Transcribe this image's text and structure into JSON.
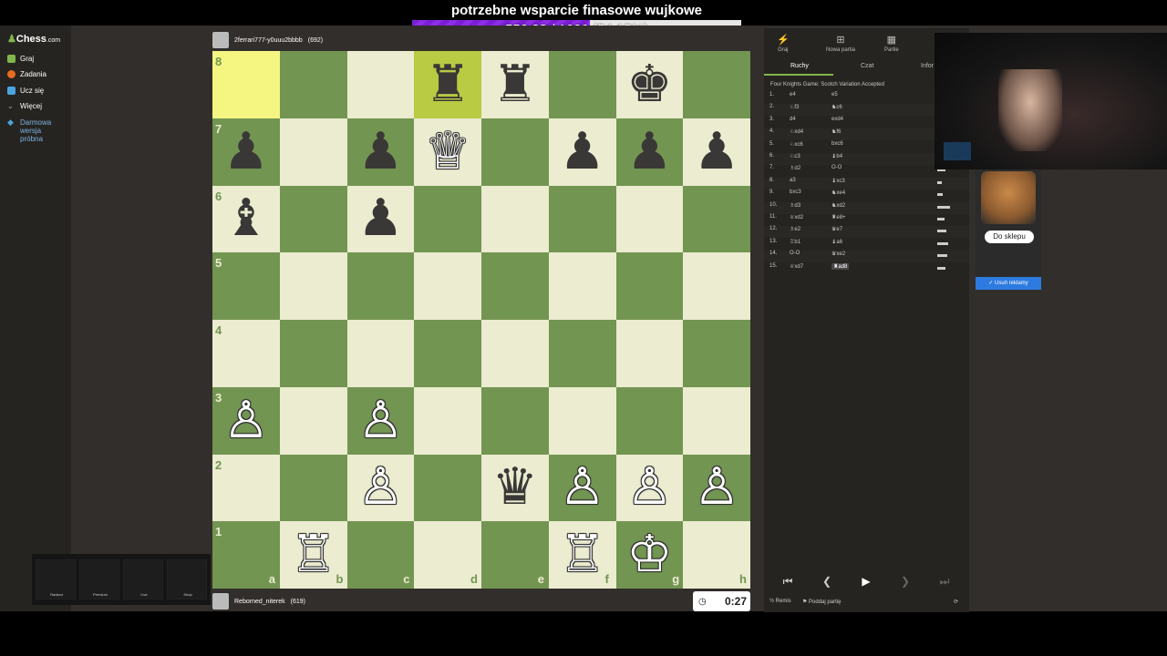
{
  "donation": {
    "title": "potrzebne wsparcie finasowe wujkowe",
    "progress_text": "552.38 / 1020 (54.15%)",
    "progress_fraction": 0.5415,
    "fill_color": "#7a1fd6"
  },
  "sidebar": {
    "logo_text": "Chess",
    "logo_suffix": ".com",
    "items": [
      {
        "label": "Graj",
        "icon": "play-icon"
      },
      {
        "label": "Zadania",
        "icon": "puzzle-icon"
      },
      {
        "label": "Ucz się",
        "icon": "learn-icon"
      },
      {
        "label": "Więcej",
        "icon": "chevron-down-icon"
      }
    ],
    "free_trial": "Darmowa wersja próbna"
  },
  "board": {
    "files": [
      "a",
      "b",
      "c",
      "d",
      "e",
      "f",
      "g",
      "h"
    ],
    "ranks": [
      "8",
      "7",
      "6",
      "5",
      "4",
      "3",
      "2",
      "1"
    ],
    "highlight": [
      "a8",
      "d8"
    ],
    "pieces": [
      {
        "sq": "d8",
        "p": "♜",
        "c": "b"
      },
      {
        "sq": "e8",
        "p": "♜",
        "c": "b"
      },
      {
        "sq": "g8",
        "p": "♚",
        "c": "b"
      },
      {
        "sq": "a7",
        "p": "♟",
        "c": "b"
      },
      {
        "sq": "c7",
        "p": "♟",
        "c": "b"
      },
      {
        "sq": "d7",
        "p": "♕",
        "c": "w"
      },
      {
        "sq": "f7",
        "p": "♟",
        "c": "b"
      },
      {
        "sq": "g7",
        "p": "♟",
        "c": "b"
      },
      {
        "sq": "h7",
        "p": "♟",
        "c": "b"
      },
      {
        "sq": "a6",
        "p": "♝",
        "c": "b"
      },
      {
        "sq": "c6",
        "p": "♟",
        "c": "b"
      },
      {
        "sq": "a3",
        "p": "♙",
        "c": "w"
      },
      {
        "sq": "c3",
        "p": "♙",
        "c": "w"
      },
      {
        "sq": "c2",
        "p": "♙",
        "c": "w"
      },
      {
        "sq": "e2",
        "p": "♛",
        "c": "b"
      },
      {
        "sq": "f2",
        "p": "♙",
        "c": "w"
      },
      {
        "sq": "g2",
        "p": "♙",
        "c": "w"
      },
      {
        "sq": "h2",
        "p": "♙",
        "c": "w"
      },
      {
        "sq": "b1",
        "p": "♖",
        "c": "w"
      },
      {
        "sq": "f1",
        "p": "♖",
        "c": "w"
      },
      {
        "sq": "g1",
        "p": "♔",
        "c": "w"
      }
    ]
  },
  "top_player": {
    "name": "2ferrari777-y0uuu2bbbb",
    "rating": "(692)"
  },
  "bottom_player": {
    "name": "Reborned_niterek",
    "rating": "(619)"
  },
  "clock": {
    "time": "0:27"
  },
  "panel": {
    "tabs": [
      {
        "label": "Graj",
        "icon": "lightning-icon"
      },
      {
        "label": "Nowa partia",
        "icon": "plus-icon"
      },
      {
        "label": "Partie",
        "icon": "grid-icon"
      }
    ],
    "subtabs": [
      "Ruchy",
      "Czat",
      "Infor"
    ],
    "opening": "Four Knights Game: Scotch Variation Accepted",
    "moves": [
      {
        "n": "1.",
        "w": "e4",
        "b": "e5"
      },
      {
        "n": "2.",
        "w": "♘f3",
        "b": "♞c6"
      },
      {
        "n": "3.",
        "w": "d4",
        "b": "exd4"
      },
      {
        "n": "4.",
        "w": "♘xd4",
        "b": "♞f6"
      },
      {
        "n": "5.",
        "w": "♘xc6",
        "b": "bxc6"
      },
      {
        "n": "6.",
        "w": "♘c3",
        "b": "♝b4"
      },
      {
        "n": "7.",
        "w": "♗d2",
        "b": "O-O"
      },
      {
        "n": "8.",
        "w": "a3",
        "b": "♝xc3"
      },
      {
        "n": "9.",
        "w": "bxc3",
        "b": "♞xe4"
      },
      {
        "n": "10.",
        "w": "♗d3",
        "b": "♞xd2"
      },
      {
        "n": "11.",
        "w": "♕xd2",
        "b": "♜e8+"
      },
      {
        "n": "12.",
        "w": "♗e2",
        "b": "♛e7"
      },
      {
        "n": "13.",
        "w": "♖b1",
        "b": "♝a6"
      },
      {
        "n": "14.",
        "w": "O-O",
        "b": "♛xe2"
      },
      {
        "n": "15.",
        "w": "♕xd7",
        "b": "♜ad8"
      }
    ],
    "footer": {
      "draw": "Remis",
      "resign": "Poddaj partię"
    }
  },
  "ad": {
    "button": "Do sklepu",
    "remove": "Usuń reklamy"
  },
  "overlay": {
    "items": [
      "Ranked",
      "Premium",
      "Live",
      "Shop"
    ]
  }
}
